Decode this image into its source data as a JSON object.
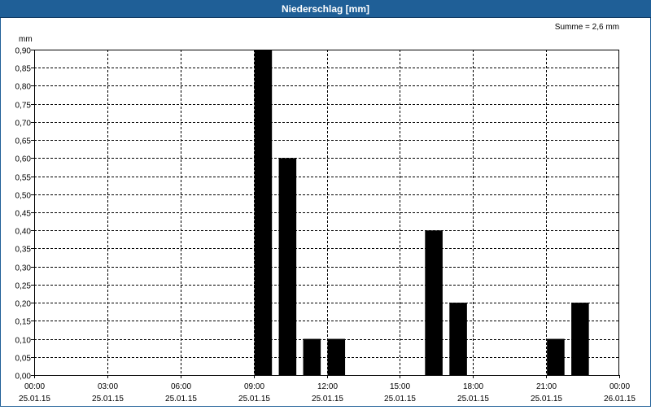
{
  "window": {
    "title": "Niederschlag [mm]"
  },
  "summary": "Summe = 2,6 mm",
  "chart_data": {
    "type": "bar",
    "title": "Niederschlag [mm]",
    "ylabel": "mm",
    "ylim": [
      0,
      0.9
    ],
    "ytick_step": 0.05,
    "ytick_labels": [
      "0,00",
      "0,05",
      "0,10",
      "0,15",
      "0,20",
      "0,25",
      "0,30",
      "0,35",
      "0,40",
      "0,45",
      "0,50",
      "0,55",
      "0,60",
      "0,65",
      "0,70",
      "0,75",
      "0,80",
      "0,85",
      "0,90"
    ],
    "xlim_hours": [
      0,
      24
    ],
    "xticks": [
      {
        "hour": 0,
        "time": "00:00",
        "date": "25.01.15"
      },
      {
        "hour": 3,
        "time": "03:00",
        "date": "25.01.15"
      },
      {
        "hour": 6,
        "time": "06:00",
        "date": "25.01.15"
      },
      {
        "hour": 9,
        "time": "09:00",
        "date": "25.01.15"
      },
      {
        "hour": 12,
        "time": "12:00",
        "date": "25.01.15"
      },
      {
        "hour": 15,
        "time": "15:00",
        "date": "25.01.15"
      },
      {
        "hour": 18,
        "time": "18:00",
        "date": "25.01.15"
      },
      {
        "hour": 21,
        "time": "21:00",
        "date": "25.01.15"
      },
      {
        "hour": 24,
        "time": "00:00",
        "date": "26.01.15"
      }
    ],
    "bars": [
      {
        "hour": 9,
        "value": 0.9
      },
      {
        "hour": 10,
        "value": 0.6
      },
      {
        "hour": 11,
        "value": 0.1
      },
      {
        "hour": 12,
        "value": 0.1
      },
      {
        "hour": 16,
        "value": 0.4
      },
      {
        "hour": 17,
        "value": 0.2
      },
      {
        "hour": 21,
        "value": 0.1
      },
      {
        "hour": 22,
        "value": 0.2
      }
    ],
    "grid": true,
    "bar_color": "#000000"
  },
  "colors": {
    "titlebar": "#1f5f97",
    "bars": "#000000",
    "grid": "#000000"
  }
}
